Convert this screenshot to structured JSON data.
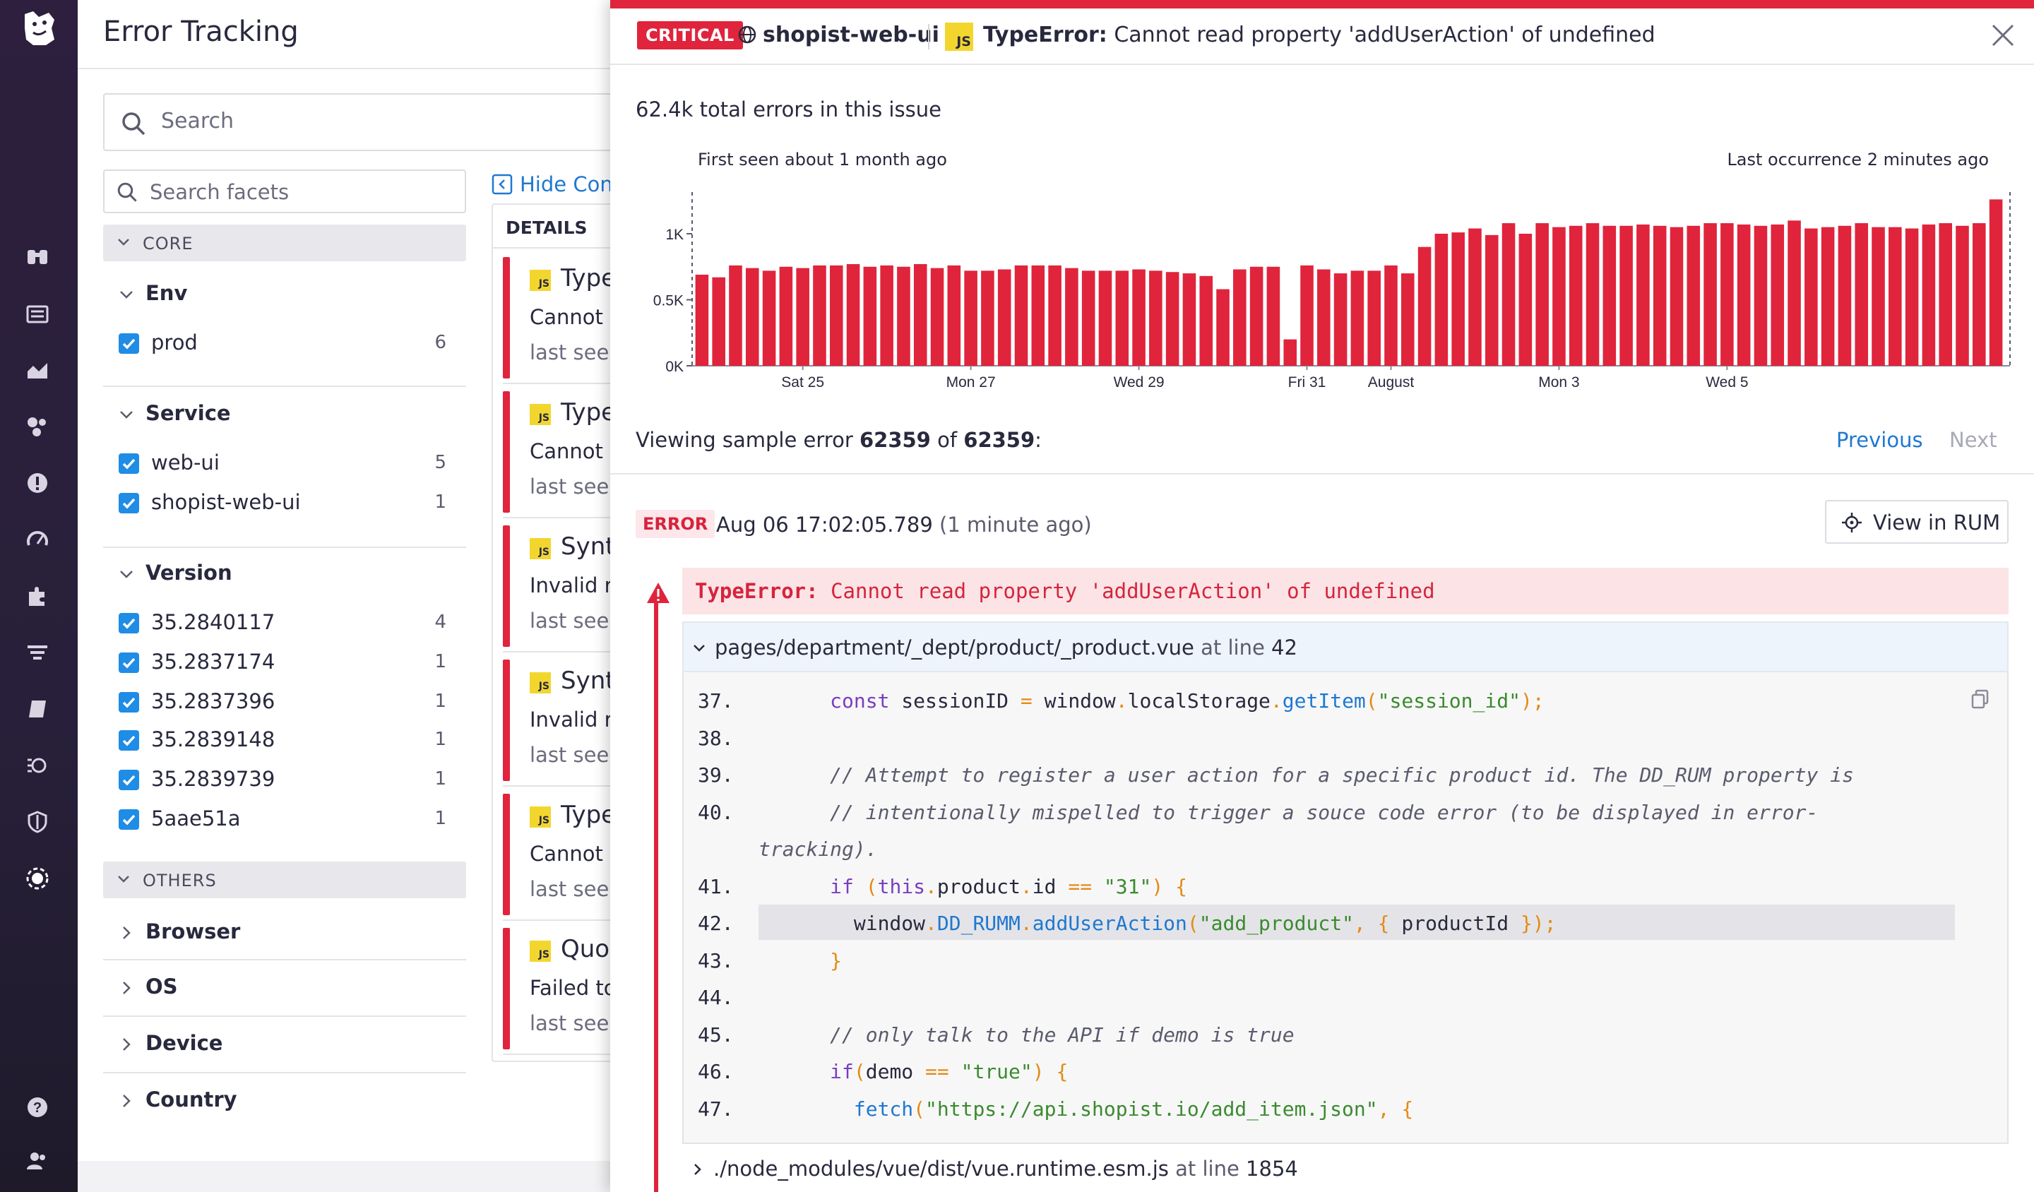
{
  "app": {
    "title": "Error Tracking"
  },
  "search": {
    "placeholder": "Search"
  },
  "facets": {
    "search_placeholder": "Search facets",
    "core_label": "CORE",
    "others_label": "OTHERS",
    "env": {
      "title": "Env",
      "items": [
        {
          "label": "prod",
          "count": "6"
        }
      ]
    },
    "service": {
      "title": "Service",
      "items": [
        {
          "label": "web-ui",
          "count": "5"
        },
        {
          "label": "shopist-web-ui",
          "count": "1"
        }
      ]
    },
    "version": {
      "title": "Version",
      "items": [
        {
          "label": "35.2840117",
          "count": "4"
        },
        {
          "label": "35.2837174",
          "count": "1"
        },
        {
          "label": "35.2837396",
          "count": "1"
        },
        {
          "label": "35.2839148",
          "count": "1"
        },
        {
          "label": "35.2839739",
          "count": "1"
        },
        {
          "label": "5aae51a",
          "count": "1"
        }
      ]
    },
    "others": [
      "Browser",
      "OS",
      "Device",
      "Country"
    ]
  },
  "details": {
    "hide_controls": "Hide Controls",
    "header": "DETAILS",
    "cards": [
      {
        "title": "Type",
        "line2": "Cannot r",
        "line3": "last seen"
      },
      {
        "title": "Type",
        "line2": "Cannot r",
        "line3": "last seen"
      },
      {
        "title": "Synt",
        "line2": "Invalid re",
        "line3": "last seen"
      },
      {
        "title": "Synt",
        "line2": "Invalid re",
        "line3": "last seen"
      },
      {
        "title": "Type",
        "line2": "Cannot r",
        "line3": "last seen"
      },
      {
        "title": "Quo",
        "line2": "Failed to",
        "line3": "last seen"
      }
    ]
  },
  "issue": {
    "severity": "CRITICAL",
    "service": "shopist-web-ui",
    "lang_badge": "JS",
    "error_type": "TypeError:",
    "error_message": "Cannot read property 'addUserAction' of undefined",
    "total": "62.4k total errors in this issue",
    "first_seen": "First seen about 1 month ago",
    "last_occurrence": "Last occurrence 2 minutes ago",
    "viewing_prefix": "Viewing sample error ",
    "viewing_current": "62359",
    "viewing_of": " of ",
    "viewing_total": "62359",
    "viewing_suffix": ":",
    "previous": "Previous",
    "next": "Next",
    "error_tag": "ERROR",
    "error_time": "Aug 06 17:02:05.789",
    "error_ago": "(1 minute ago)",
    "view_in_rum": "View in RUM",
    "banner_type": "TypeError:",
    "banner_message": " Cannot read property 'addUserAction' of undefined",
    "frame1_path": "pages/department/_dept/product/_product.vue",
    "frame1_at": " at line ",
    "frame1_line": "42",
    "frame2_path": "./node_modules/vue/dist/vue.runtime.esm.js",
    "frame2_at": " at line ",
    "frame2_line": "1854"
  },
  "code_lines": [
    {
      "n": "37.",
      "code": "      const sessionID = window.localStorage.getItem(\"session_id\");"
    },
    {
      "n": "38.",
      "code": ""
    },
    {
      "n": "39.",
      "code": "      // Attempt to register a user action for a specific product id. The DD_RUM property is"
    },
    {
      "n": "40.",
      "code": "      // intentionally mispelled to trigger a souce code error (to be displayed in error-"
    },
    {
      "n": "",
      "code": "tracking)."
    },
    {
      "n": "41.",
      "code": "      if (this.product.id == \"31\") {"
    },
    {
      "n": "42.",
      "code": "        window.DD_RUMM.addUserAction(\"add_product\", { productId });"
    },
    {
      "n": "43.",
      "code": "      }"
    },
    {
      "n": "44.",
      "code": ""
    },
    {
      "n": "45.",
      "code": "      // only talk to the API if demo is true"
    },
    {
      "n": "46.",
      "code": "      if(demo == \"true\") {"
    },
    {
      "n": "47.",
      "code": "        fetch(\"https://api.shopist.io/add_item.json\", {"
    }
  ],
  "chart_data": {
    "type": "bar",
    "title": "",
    "xlabel": "",
    "ylabel": "",
    "ylim": [
      0,
      1000
    ],
    "yticks": [
      "0K",
      "0.5K",
      "1K"
    ],
    "xticks": [
      {
        "label": "Sat 25",
        "index": 6
      },
      {
        "label": "Mon 27",
        "index": 16
      },
      {
        "label": "Wed 29",
        "index": 26
      },
      {
        "label": "Fri 31",
        "index": 36
      },
      {
        "label": "August",
        "index": 41
      },
      {
        "label": "Mon 3",
        "index": 51
      },
      {
        "label": "Wed 5",
        "index": 61
      }
    ],
    "color": "#e0243c",
    "values": [
      690,
      670,
      760,
      740,
      720,
      750,
      740,
      760,
      760,
      770,
      750,
      760,
      750,
      770,
      740,
      760,
      720,
      720,
      730,
      760,
      760,
      760,
      740,
      720,
      720,
      720,
      730,
      720,
      710,
      700,
      680,
      580,
      730,
      750,
      750,
      200,
      760,
      730,
      700,
      720,
      720,
      760,
      700,
      900,
      1000,
      1010,
      1040,
      990,
      1080,
      1000,
      1080,
      1050,
      1060,
      1080,
      1060,
      1060,
      1070,
      1060,
      1050,
      1060,
      1080,
      1080,
      1070,
      1060,
      1070,
      1100,
      1040,
      1050,
      1060,
      1080,
      1050,
      1050,
      1040,
      1070,
      1080,
      1060,
      1080,
      1260
    ]
  },
  "colors": {
    "accent": "#1f78d1",
    "critical": "#e0243c",
    "nav_bg": "#2d1f3d"
  }
}
